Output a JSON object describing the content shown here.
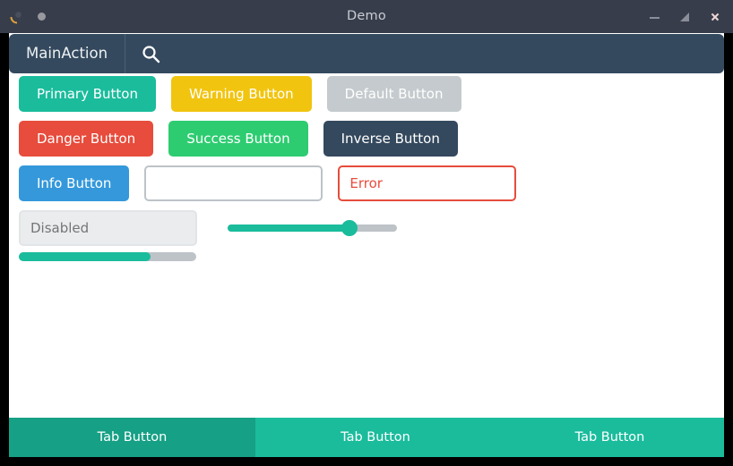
{
  "window": {
    "title": "Demo",
    "app_icon": "app-logo-icon",
    "status_dot": "status-dot-icon",
    "controls": {
      "minimize": "minimize-icon",
      "maximize": "maximize-icon",
      "close": "close-icon"
    }
  },
  "toolbar": {
    "main_action_label": "MainAction",
    "search_icon": "search-icon"
  },
  "buttons": {
    "primary": "Primary Button",
    "warning": "Warning Button",
    "default": "Default Button",
    "danger": "Danger Button",
    "success": "Success Button",
    "inverse": "Inverse Button",
    "info": "Info Button"
  },
  "inputs": {
    "plain": {
      "value": "",
      "placeholder": ""
    },
    "error": {
      "value": "Error",
      "placeholder": ""
    },
    "disabled": {
      "value": "",
      "placeholder": "Disabled"
    }
  },
  "slider": {
    "value": 72,
    "min": 0,
    "max": 100
  },
  "progress": {
    "value": 74,
    "min": 0,
    "max": 100
  },
  "tabs": [
    {
      "label": "Tab Button",
      "active": true
    },
    {
      "label": "Tab Button",
      "active": false
    },
    {
      "label": "Tab Button",
      "active": false
    }
  ],
  "colors": {
    "primary": "#1abc9c",
    "primary_dark": "#16a085",
    "warning": "#f1c40f",
    "default": "#c4cacd",
    "danger": "#e74c3c",
    "success": "#2ecc71",
    "inverse": "#34495e",
    "info": "#3498db",
    "titlebar": "#373d4b",
    "close": "#d8504b"
  }
}
